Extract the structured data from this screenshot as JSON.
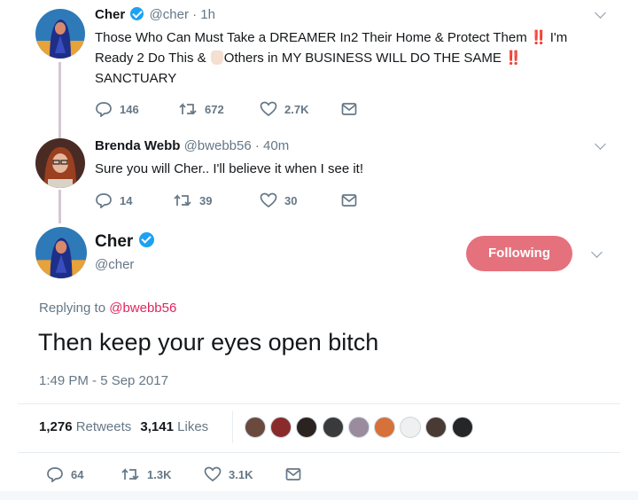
{
  "tweet1": {
    "name": "Cher",
    "handle": "@cher",
    "time": "· 1h",
    "line1": "Those Who Can Must Take a DREAMER In2 Their Home & Protect Them",
    "bang": "‼️",
    "line1_end": "I'm",
    "line2_start": "Ready 2 Do This &",
    "line2_mid": "Others in MY BUSINESS WILL DO THE SAME",
    "line3": "SANCTUARY",
    "replies": "146",
    "retweets": "672",
    "likes": "2.7K"
  },
  "tweet2": {
    "name": "Brenda Webb",
    "handle": "@bwebb56",
    "time": "· 40m",
    "text": "Sure you will Cher.. I'll believe it when I see it!",
    "replies": "14",
    "retweets": "39",
    "likes": "30"
  },
  "main": {
    "name": "Cher",
    "handle": "@cher",
    "follow_label": "Following",
    "replying_prefix": "Replying to",
    "replying_to": "@bwebb56",
    "text": "Then keep your eyes open bitch",
    "timestamp": "1:49 PM - 5 Sep 2017",
    "retweet_count": "1,276",
    "retweet_label": "Retweets",
    "like_count": "3,141",
    "like_label": "Likes",
    "replies": "64",
    "retweets": "1.3K",
    "likes": "3.1K"
  },
  "colors": {
    "accent_link": "#e0245e",
    "follow_button": "#e5717d",
    "muted": "#657786",
    "verified": "#1da1f2"
  },
  "icons": [
    "reply-icon",
    "retweet-icon",
    "like-icon",
    "dm-icon",
    "verified-badge-icon",
    "chevron-down-icon"
  ]
}
